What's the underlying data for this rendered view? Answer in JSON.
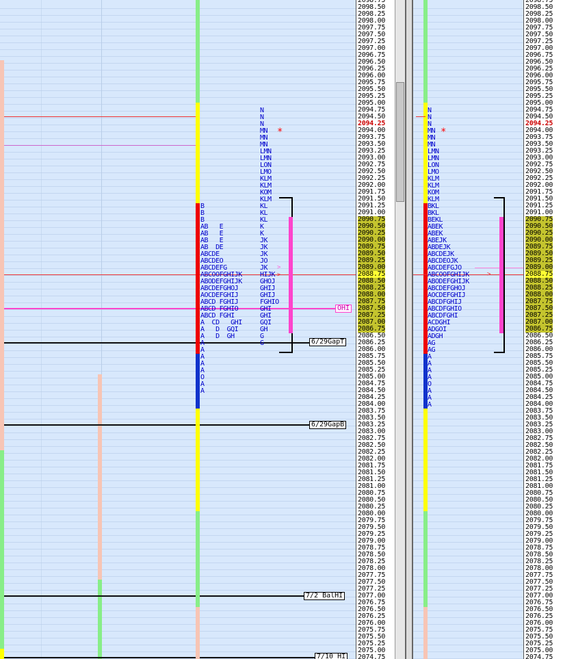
{
  "price_scale": [
    "2098.75",
    "2098.50",
    "2098.25",
    "2098.00",
    "2097.75",
    "2097.50",
    "2097.25",
    "2097.00",
    "2096.75",
    "2096.50",
    "2096.25",
    "2096.00",
    "2095.75",
    "2095.50",
    "2095.25",
    "2095.00",
    "2094.75",
    "2094.50",
    "2094.25",
    "2094.00",
    "2093.75",
    "2093.50",
    "2093.25",
    "2093.00",
    "2092.75",
    "2092.50",
    "2092.25",
    "2092.00",
    "2091.75",
    "2091.50",
    "2091.25",
    "2091.00",
    "2090.75",
    "2090.50",
    "2090.25",
    "2090.00",
    "2089.75",
    "2089.50",
    "2089.25",
    "2089.00",
    "2088.75",
    "2088.50",
    "2088.25",
    "2088.00",
    "2087.75",
    "2087.50",
    "2087.25",
    "2087.00",
    "2086.75",
    "2086.50",
    "2086.25",
    "2086.00",
    "2085.75",
    "2085.50",
    "2085.25",
    "2085.00",
    "2084.75",
    "2084.50",
    "2084.25",
    "2084.00",
    "2083.75",
    "2083.50",
    "2083.25",
    "2083.00",
    "2082.75",
    "2082.50",
    "2082.25",
    "2082.00",
    "2081.75",
    "2081.50",
    "2081.25",
    "2081.00",
    "2080.75",
    "2080.50",
    "2080.25",
    "2080.00",
    "2079.75",
    "2079.50",
    "2079.25",
    "2079.00",
    "2078.75",
    "2078.50",
    "2078.25",
    "2078.00",
    "2077.75",
    "2077.50",
    "2077.25",
    "2077.00",
    "2076.75",
    "2076.50",
    "2076.25",
    "2076.00",
    "2075.75",
    "2075.50",
    "2075.25",
    "2075.00",
    "2074.75"
  ],
  "last_price": "2094.25",
  "poc_price": "2088.75",
  "value_area": {
    "high": "2090.75",
    "low": "2086.75"
  },
  "reference_labels": {
    "ohi": "OHI",
    "gap_top": "6/29GapT",
    "gap_bottom": "6/29GapB",
    "bal_hi": "7/2 BalHI",
    "hi_710": "7/10 HI"
  },
  "marker_star": "*",
  "profile_left": [
    "N",
    "N",
    "N",
    "MN",
    "MN",
    "MN",
    "LMN",
    "LMN",
    "LON",
    "LMO",
    "KLM",
    "KLM",
    "KOM",
    "KLM",
    "KL",
    "KL",
    "KL",
    "K",
    "K",
    "JK",
    "JK",
    "JK",
    "JO",
    "JK",
    "HIJK",
    "GHOJ",
    "GHIJ",
    "GHIJ",
    "FGHIO",
    "GHI",
    "GHI",
    "GQI",
    "GH",
    "G",
    "G"
  ],
  "profile_left_ab": [
    "B",
    "B",
    "B",
    "AB   E",
    "AB   E",
    "AB   E",
    "AB  DE",
    "ABCDE",
    "ABCDEO",
    "ABCDEFG",
    "ABCOOFGHIJK",
    "ABODEFGHIJK",
    "ABCDEFGHOJ",
    "AOCDEFGHIJ",
    "ABCD FGHIJ",
    "ABCD FGHIO",
    "ABCD FGHI",
    "A  CD   GHI",
    "A   D  GQI",
    "A   D  GH",
    "A",
    "A",
    "A",
    "A",
    "A",
    "O",
    "A",
    "A"
  ],
  "profile_right": [
    "N",
    "N",
    "N",
    "MN",
    "MN",
    "MN",
    "LMN",
    "LMN",
    "LON",
    "LMO",
    "KLM",
    "KLM",
    "KOM",
    "KLM",
    "BKL",
    "BKL",
    "BEKL",
    "ABEK",
    "ABEK",
    "ABEJK",
    "ABDEJK",
    "ABCDEJK",
    "ABCDEOJK",
    "ABCDEFGJO",
    "ABCOOFGHIJK",
    "ABODEFGHIJK",
    "ABCDEFGHOJ",
    "AOCDEFGHIJ",
    "ABCDFGHIJ",
    "ABCDFGHIO",
    "ABCDFGHI",
    "ACDGHI",
    "ADGOI",
    "ADGH",
    "AG",
    "AG",
    "A",
    "A",
    "A",
    "A",
    "O",
    "A",
    "A",
    "A"
  ],
  "colors": {
    "value_area": "#c4c42e",
    "poc": "#ffff33",
    "last_price": "#cc0000",
    "pink": "#ff44cc",
    "salmon": "#f7c5b5",
    "green": "#88ee88",
    "yellow": "#ffff00",
    "red": "#ee0000",
    "blue": "#1133cc"
  }
}
